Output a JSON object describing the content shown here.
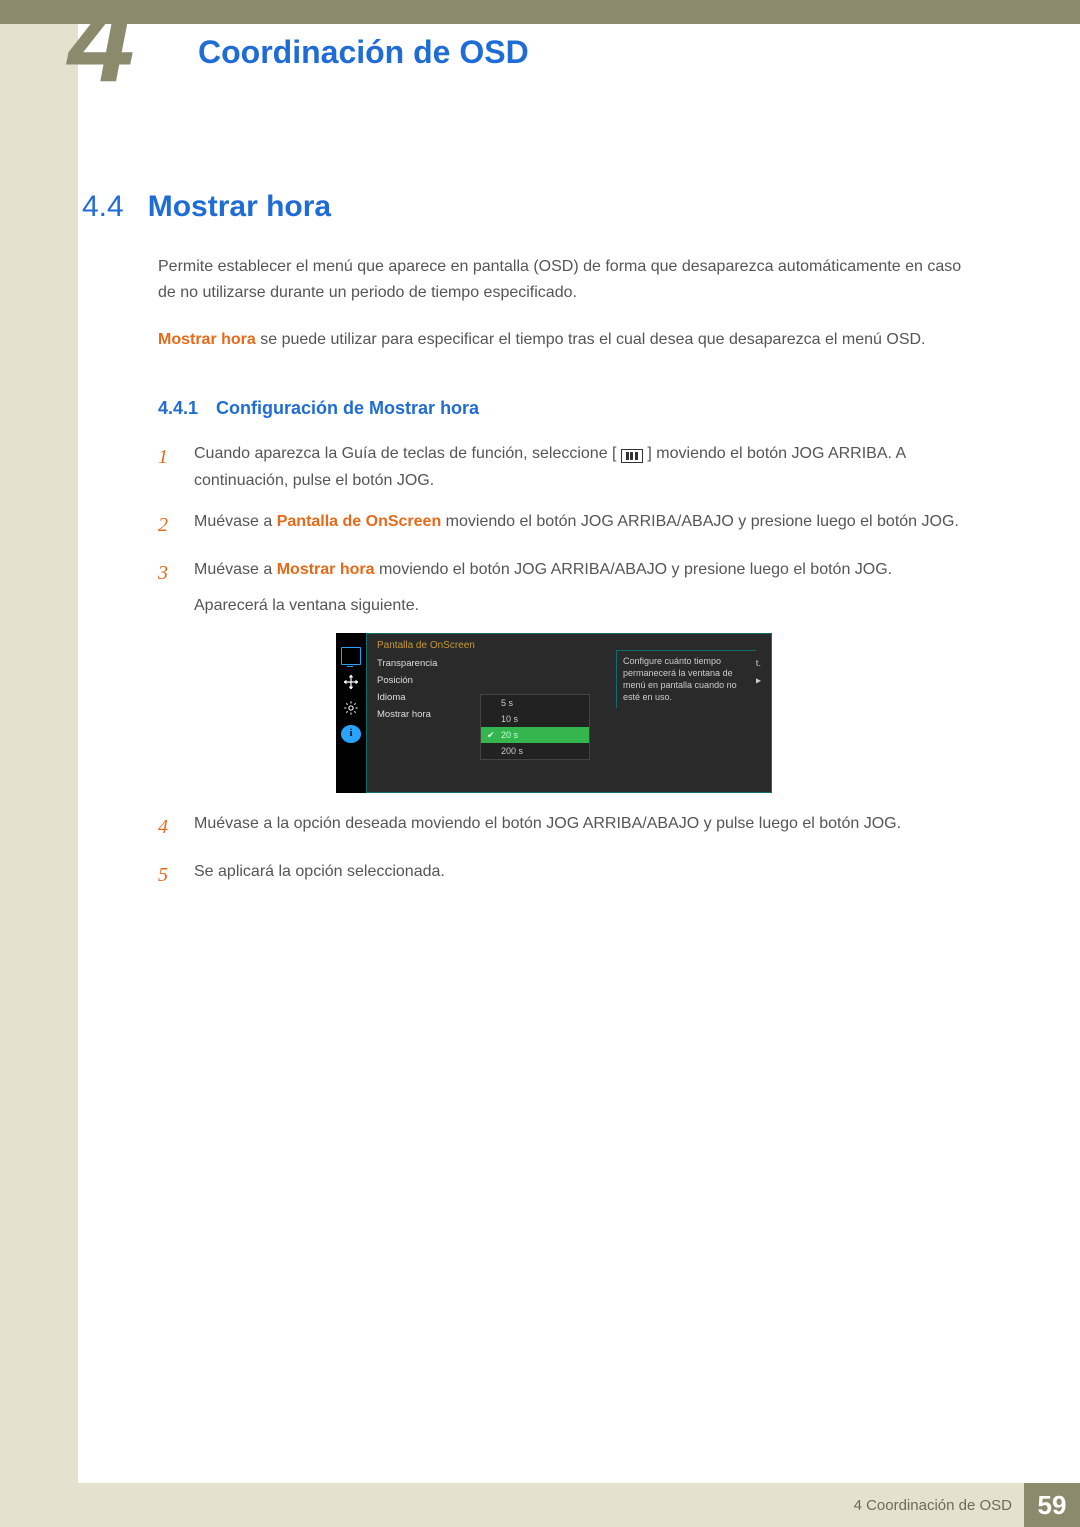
{
  "header": {
    "chapter_number": "4",
    "chapter_title": "Coordinación de OSD"
  },
  "section": {
    "number": "4.4",
    "title": "Mostrar hora"
  },
  "intro": {
    "p1": "Permite establecer el menú que aparece en pantalla (OSD) de forma que desaparezca automáticamente en caso de no utilizarse durante un periodo de tiempo especificado.",
    "p2_hl": "Mostrar hora",
    "p2_rest": " se puede utilizar para especificar el tiempo tras el cual desea que desaparezca el menú OSD."
  },
  "subsection": {
    "number": "4.4.1",
    "title": "Configuración de Mostrar hora"
  },
  "steps": {
    "s1_a": "Cuando aparezca la Guía de teclas de función, seleccione [",
    "s1_b": "] moviendo el botón JOG ARRIBA. A continuación, pulse el botón JOG.",
    "s2_a": "Muévase a ",
    "s2_hl": "Pantalla de OnScreen",
    "s2_b": " moviendo el botón JOG ARRIBA/ABAJO y presione luego el botón JOG.",
    "s3_a": "Muévase a ",
    "s3_hl": "Mostrar hora",
    "s3_b": " moviendo el botón JOG ARRIBA/ABAJO y presione luego el botón JOG.",
    "s3_c": "Aparecerá la ventana siguiente.",
    "s4": "Muévase a la opción deseada moviendo el botón JOG ARRIBA/ABAJO y pulse luego el botón JOG.",
    "s5": "Se aplicará la opción seleccionada."
  },
  "step_numbers": {
    "n1": "1",
    "n2": "2",
    "n3": "3",
    "n4": "4",
    "n5": "5"
  },
  "osd": {
    "header": "Pantalla de OnScreen",
    "rows": {
      "transparencia": "Transparencia",
      "transparencia_val": "Act.",
      "posicion": "Posición",
      "idioma": "Idioma",
      "mostrar": "Mostrar hora"
    },
    "options": {
      "o1": "5 s",
      "o2": "10 s",
      "o3": "20 s",
      "o4": "200 s"
    },
    "hint": "Configure cuánto tiempo permanecerá la ventana de menú en pantalla cuando no esté en uso."
  },
  "footer": {
    "label": "4 Coordinación de OSD",
    "page": "59"
  }
}
